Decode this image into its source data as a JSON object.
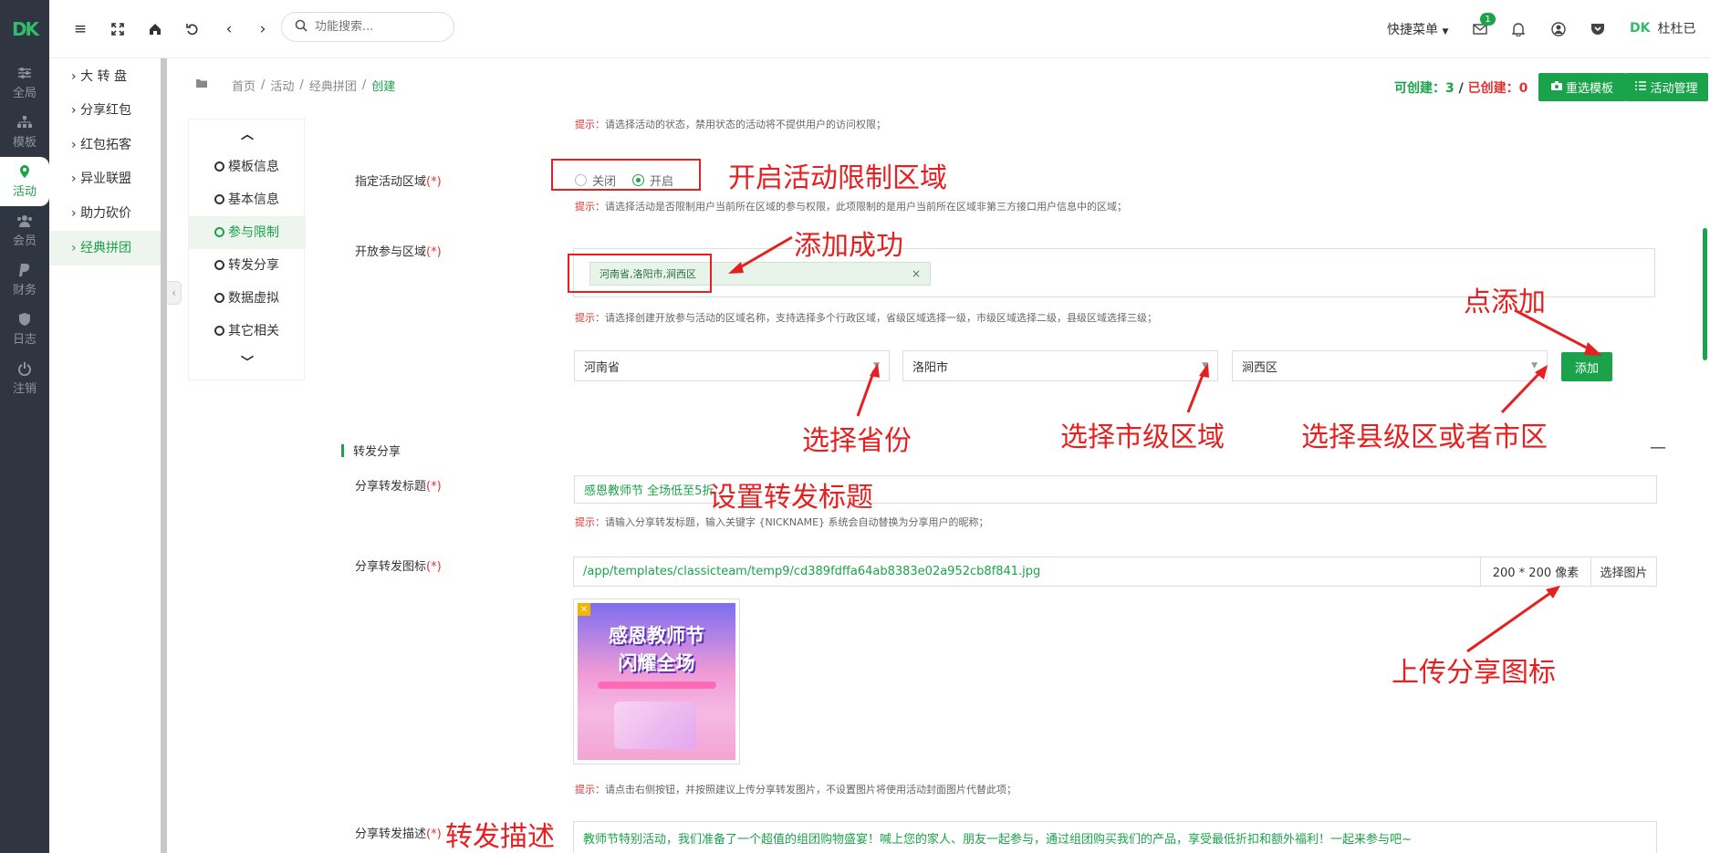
{
  "app": {
    "logo": "DK"
  },
  "rail": [
    {
      "label": "全局",
      "icon": "sliders-icon"
    },
    {
      "label": "模板",
      "icon": "sitemap-icon"
    },
    {
      "label": "活动",
      "icon": "location-icon"
    },
    {
      "label": "会员",
      "icon": "users-icon"
    },
    {
      "label": "财务",
      "icon": "paypal-icon"
    },
    {
      "label": "日志",
      "icon": "shield-icon"
    },
    {
      "label": "注销",
      "icon": "power-icon"
    }
  ],
  "subnav": [
    "大 转 盘",
    "分享红包",
    "红包拓客",
    "异业联盟",
    "助力砍价",
    "经典拼团"
  ],
  "topbar": {
    "search_placeholder": "功能搜索...",
    "quick_menu": "快捷菜单",
    "mail_badge": "1",
    "user_name": "杜杜已",
    "user_logo": "DK"
  },
  "breadcrumb": [
    "首页",
    "活动",
    "经典拼团",
    "创建"
  ],
  "counts": {
    "can_create_label": "可创建：",
    "can_create": "3",
    "separator": " / ",
    "created_label": "已创建：",
    "created": "0"
  },
  "buttons": {
    "reselect_template": "重选模板",
    "activity_manage": "活动管理",
    "add": "添加",
    "pick_image": "选择图片"
  },
  "anchors": [
    "模板信息",
    "基本信息",
    "参与限制",
    "转发分享",
    "数据虚拟",
    "其它相关"
  ],
  "form": {
    "tip_prefix": "提示：",
    "top_tip": "请选择活动的状态，禁用状态的活动将不提供用户的访问权限；",
    "region_label": "指定活动区域",
    "req_mark": "(*)",
    "radio_off": "关闭",
    "radio_on": "开启",
    "region_tip": "请选择活动是否限制用户当前所在区域的参与权限，此项限制的是用户当前所在区域非第三方接口用户信息中的区域；",
    "open_region_label": "开放参与区域",
    "region_tag": "河南省,洛阳市,涧西区",
    "open_region_tip": "请选择创建开放参与活动的区域名称，支持选择多个行政区域，省级区域选择一级，市级区域选择二级，县级区域选择三级；",
    "province": "河南省",
    "city": "洛阳市",
    "county": "涧西区",
    "section_title": "转发分享",
    "share_title_label": "分享转发标题",
    "share_title_value": "感恩教师节 全场低至5折",
    "share_title_tip": "请输入分享转发标题，输入关键字 {NICKNAME} 系统会自动替换为分享用户的昵称；",
    "share_icon_label": "分享转发图标",
    "share_icon_path": "/app/templates/classicteam/temp9/cd389fdffa64ab8383e02a952cb8f841.jpg",
    "share_icon_size": "200 * 200 像素",
    "thumb_line1": "感恩教师节",
    "thumb_line2": "闪耀全场",
    "share_icon_tip": "请点击右侧按钮，并按照建议上传分享转发图片，不设置图片将使用活动封面图片代替此项；",
    "share_desc_label": "分享转发描述",
    "share_desc_value": "教师节特别活动，我们准备了一个超值的组团购物盛宴！喊上您的家人、朋友一起参与，通过组团购买我们的产品，享受最低折扣和额外福利！一起来参与吧~"
  },
  "annotations": {
    "open_limit": "开启活动限制区域",
    "added": "添加成功",
    "click_add": "点添加",
    "pick_province": "选择省份",
    "pick_city": "选择市级区域",
    "pick_county": "选择县级区或者市区",
    "set_title": "设置转发标题",
    "upload_icon": "上传分享图标",
    "share_desc": "转发描述"
  },
  "colors": {
    "accent": "#1aa34a",
    "annotation": "#e62020",
    "rail_bg": "#2f3541"
  }
}
